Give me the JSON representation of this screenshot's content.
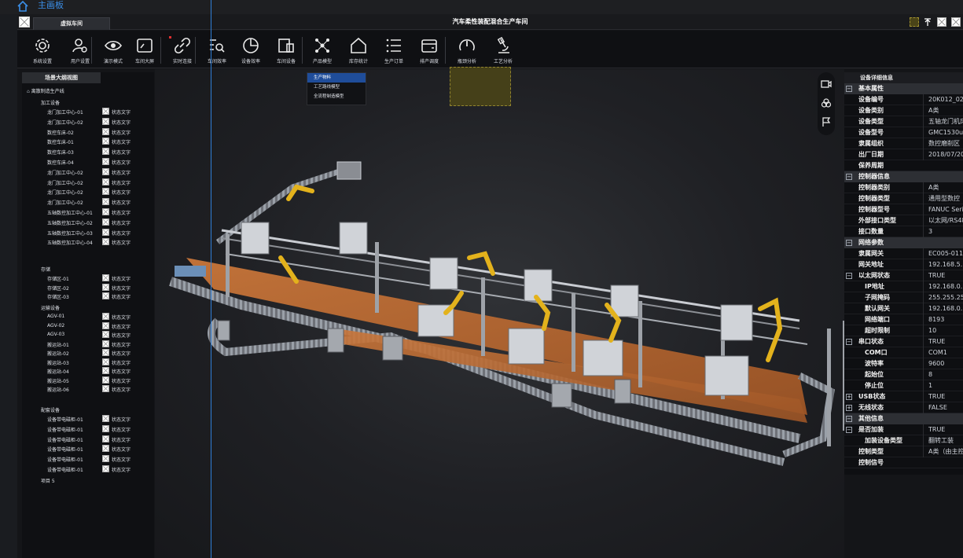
{
  "topbar": {
    "home_label": "主画板"
  },
  "window": {
    "tab": "虚拟车间",
    "title": "汽车柔性装配混合生产车间"
  },
  "toolbar": {
    "items": [
      {
        "label": "系统设置",
        "icon": "gear-icon"
      },
      {
        "label": "用户设置",
        "icon": "user-settings-icon"
      },
      {
        "label": "演示模式",
        "icon": "eye-icon"
      },
      {
        "label": "车间大屏",
        "icon": "screen-icon"
      },
      {
        "label": "实时连接",
        "icon": "link-icon"
      },
      {
        "label": "车间效率",
        "icon": "search-list-icon"
      },
      {
        "label": "设备效率",
        "icon": "pie-icon"
      },
      {
        "label": "车间设备",
        "icon": "device-icon"
      },
      {
        "label": "产品模型",
        "icon": "product-model-icon"
      },
      {
        "label": "库存统计",
        "icon": "warehouse-icon"
      },
      {
        "label": "生产订单",
        "icon": "order-list-icon"
      },
      {
        "label": "排产调度",
        "icon": "wallet-icon"
      },
      {
        "label": "瓶颈分析",
        "icon": "gauge-icon"
      },
      {
        "label": "工艺分析",
        "icon": "microscope-icon"
      }
    ]
  },
  "dropdown": {
    "items": [
      "生产物料",
      "工艺路线模型",
      "全流程制造模型"
    ]
  },
  "left_panel": {
    "title": "场景大纲视图",
    "root": "离散制造生产线",
    "groups": [
      {
        "name": "加工设备",
        "items": [
          "龙门加工中心-01",
          "龙门加工中心-02",
          "数控车床-02",
          "数控车床-01",
          "数控车床-03",
          "数控车床-04",
          "龙门加工中心-02",
          "龙门加工中心-02",
          "龙门加工中心-02",
          "龙门加工中心-02",
          "五轴数控加工中心-01",
          "五轴数控加工中心-02",
          "五轴数控加工中心-03",
          "五轴数控加工中心-04"
        ]
      },
      {
        "name": "存储",
        "items": [
          "存储区-01",
          "存储区-02",
          "存储区-03"
        ]
      },
      {
        "name": "运输设备",
        "items": [
          "AGV-01",
          "AGV-02",
          "AGV-03",
          "搬运站-01",
          "搬运站-02",
          "搬运站-03",
          "搬运站-04",
          "搬运站-05",
          "搬运站-06"
        ]
      },
      {
        "name": "配套设备",
        "items": [
          "设备带电磁柜-01",
          "设备带电磁柜-01",
          "设备带电磁柜-01",
          "设备带电磁柜-01",
          "设备带电磁柜-01",
          "设备带电磁柜-01"
        ]
      }
    ],
    "tail": "项目 5",
    "status_text": "状态文字"
  },
  "right_panel": {
    "title": "设备详细信息",
    "rows": [
      {
        "type": "sec",
        "k": "基本属性"
      },
      {
        "type": "prop",
        "k": "设备编号",
        "v": "20K012_02"
      },
      {
        "type": "prop",
        "k": "设备类别",
        "v": "A类"
      },
      {
        "type": "prop",
        "k": "设备类型",
        "v": "五轴龙门机床"
      },
      {
        "type": "prop",
        "k": "设备型号",
        "v": "GMC1530u"
      },
      {
        "type": "prop",
        "k": "隶属组织",
        "v": "数控磨削区"
      },
      {
        "type": "prop",
        "k": "出厂日期",
        "v": "2018/07/20"
      },
      {
        "type": "prop",
        "k": "保养周期",
        "v": ""
      },
      {
        "type": "sec",
        "k": "控制器信息"
      },
      {
        "type": "prop",
        "k": "控制器类别",
        "v": "A类"
      },
      {
        "type": "prop",
        "k": "控制器类型",
        "v": "通用型数控"
      },
      {
        "type": "prop",
        "k": "控制器型号",
        "v": "FANUC Series"
      },
      {
        "type": "prop",
        "k": "外部接口类型",
        "v": "以太网/RS485"
      },
      {
        "type": "prop",
        "k": "接口数量",
        "v": "3"
      },
      {
        "type": "sec",
        "k": "网络参数"
      },
      {
        "type": "prop",
        "k": "隶属网关",
        "v": "EC005-011"
      },
      {
        "type": "prop",
        "k": "网关地址",
        "v": "192.168.5.1"
      },
      {
        "type": "sub",
        "k": "以太网状态",
        "v": "TRUE",
        "expand": "−"
      },
      {
        "type": "prop2",
        "k": "IP地址",
        "v": "192.168.0.1"
      },
      {
        "type": "prop2",
        "k": "子网掩码",
        "v": "255.255.255"
      },
      {
        "type": "prop2",
        "k": "默认网关",
        "v": "192.168.0.1"
      },
      {
        "type": "prop2",
        "k": "网络端口",
        "v": "8193"
      },
      {
        "type": "prop2",
        "k": "超时限制",
        "v": "10"
      },
      {
        "type": "sub",
        "k": "串口状态",
        "v": "TRUE",
        "expand": "−"
      },
      {
        "type": "prop2",
        "k": "COM口",
        "v": "COM1"
      },
      {
        "type": "prop2",
        "k": "波特率",
        "v": "9600"
      },
      {
        "type": "prop2",
        "k": "起始位",
        "v": "8"
      },
      {
        "type": "prop2",
        "k": "停止位",
        "v": "1"
      },
      {
        "type": "sub",
        "k": "USB状态",
        "v": "TRUE",
        "expand": "+"
      },
      {
        "type": "sub",
        "k": "无线状态",
        "v": "FALSE",
        "expand": "+"
      },
      {
        "type": "sec",
        "k": "其他信息"
      },
      {
        "type": "sub",
        "k": "是否加装",
        "v": "TRUE",
        "expand": "−"
      },
      {
        "type": "prop2",
        "k": "加装设备类型",
        "v": "翻转工装"
      },
      {
        "type": "prop",
        "k": "控制类型",
        "v": "A类（由主控制）"
      },
      {
        "type": "prop",
        "k": "控制信号",
        "v": ""
      }
    ]
  },
  "colors": {
    "accent": "#3b8fe8",
    "selected": "#1f4d9a",
    "conveyor": "#b8652e",
    "robot": "#e3b21c"
  }
}
